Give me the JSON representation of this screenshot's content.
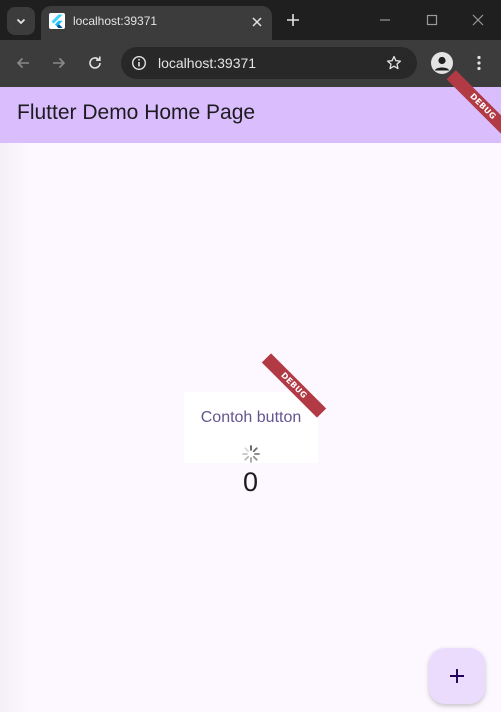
{
  "browser": {
    "tab_title": "localhost:39371",
    "url": "localhost:39371",
    "colors": {
      "frame": "#1f1f1f",
      "toolbar": "#3c3c3c",
      "omnibox": "#282828"
    }
  },
  "app": {
    "title": "Flutter Demo Home Page",
    "debug_banner": "DEBUG",
    "button_label": "Contoh button",
    "counter": "0",
    "colors": {
      "appbar": "#d9bdfd",
      "background": "#fdf7ff",
      "fab": "#ebdcfe",
      "button_text": "#65558f",
      "debug_banner": "#b13a44"
    }
  },
  "icons": {
    "tab_list": "chevron-down-icon",
    "favicon": "flutter-logo-icon",
    "tab_close": "close-icon",
    "new_tab": "plus-icon",
    "minimize": "minimize-icon",
    "maximize": "maximize-icon",
    "window_close": "close-icon",
    "back": "arrow-left-icon",
    "forward": "arrow-right-icon",
    "reload": "reload-icon",
    "site_info": "info-icon",
    "bookmark": "star-icon",
    "profile": "person-icon",
    "menu": "kebab-menu-icon",
    "loading": "spinner-icon",
    "fab": "plus-icon"
  }
}
